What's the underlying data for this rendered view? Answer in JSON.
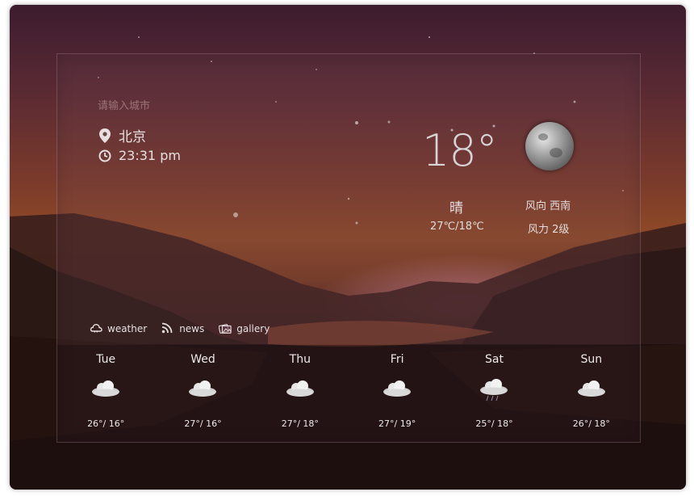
{
  "search": {
    "placeholder": "请输入城市"
  },
  "current": {
    "city": "北京",
    "time": "23:31 pm",
    "temperature": "18°",
    "condition": "晴",
    "range": "27℃/18℃",
    "wind_direction": "风向 西南",
    "wind_level": "风力 2级",
    "icon": "moon-icon"
  },
  "tabs": [
    {
      "label": "weather",
      "icon": "cloud-icon"
    },
    {
      "label": "news",
      "icon": "rss-icon"
    },
    {
      "label": "gallery",
      "icon": "gallery-icon"
    }
  ],
  "forecast": [
    {
      "day": "Tue",
      "temps": "26°/ 16°",
      "icon": "cloud-icon"
    },
    {
      "day": "Wed",
      "temps": "27°/ 16°",
      "icon": "cloud-icon"
    },
    {
      "day": "Thu",
      "temps": "27°/ 18°",
      "icon": "cloud-icon"
    },
    {
      "day": "Fri",
      "temps": "27°/ 19°",
      "icon": "cloud-icon"
    },
    {
      "day": "Sat",
      "temps": "25°/ 18°",
      "icon": "cloud-rain-icon"
    },
    {
      "day": "Sun",
      "temps": "26°/ 18°",
      "icon": "cloud-icon"
    }
  ]
}
